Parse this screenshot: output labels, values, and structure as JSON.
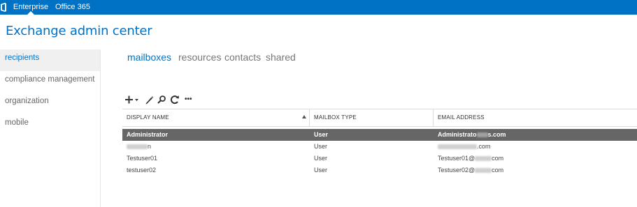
{
  "topbar": {
    "tabs": [
      {
        "label": "Enterprise",
        "active": true
      },
      {
        "label": "Office 365",
        "active": false
      }
    ],
    "color": "#0072c6"
  },
  "app": {
    "title": "Exchange admin center"
  },
  "leftnav": {
    "items": [
      {
        "label": "recipients",
        "selected": true
      },
      {
        "label": "compliance management",
        "selected": false
      },
      {
        "label": "organization",
        "selected": false
      },
      {
        "label": "mobile",
        "selected": false
      }
    ]
  },
  "subtabs": [
    {
      "label": "mailboxes",
      "active": true
    },
    {
      "label": "resources",
      "active": false
    },
    {
      "label": "contacts",
      "active": false
    },
    {
      "label": "shared",
      "active": false
    }
  ],
  "toolbar": {
    "icons": [
      "add-icon",
      "edit-icon",
      "search-icon",
      "refresh-icon",
      "more-icon"
    ],
    "more_label": "•••"
  },
  "table": {
    "columns": [
      "DISPLAY NAME",
      "MAILBOX TYPE",
      "EMAIL ADDRESS"
    ],
    "sorted_column": "DISPLAY NAME",
    "rows": [
      {
        "name": "Administrator",
        "type": "User",
        "email_prefix": "Administrato",
        "email_suffix": "s.com",
        "selected": true
      },
      {
        "name_prefix": "",
        "name_suffix": "n",
        "type": "User",
        "email_prefix": "",
        "email_suffix": ".com",
        "selected": false
      },
      {
        "name": "Testuser01",
        "type": "User",
        "email_prefix": "Testuser01@",
        "email_suffix": "com",
        "selected": false
      },
      {
        "name": "testuser02",
        "type": "User",
        "email_prefix": "Testuser02@",
        "email_suffix": "com",
        "selected": false
      }
    ]
  }
}
